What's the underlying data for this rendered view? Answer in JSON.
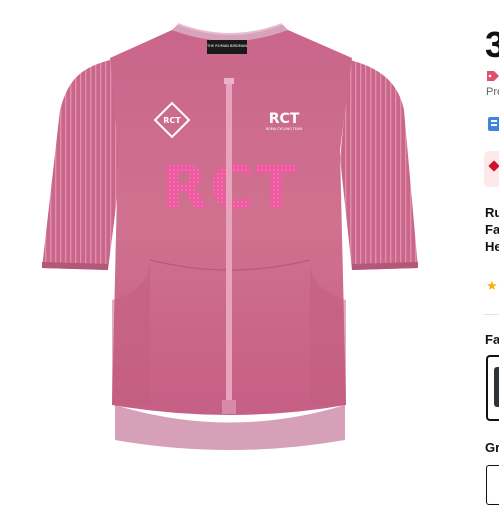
{
  "product": {
    "tag_label": "THE ROMAN BIRDMAN",
    "chest_badge": "RCT",
    "chest_logo": "RCT",
    "chest_sub": "ROMA CYCLING TEAM",
    "front_print": "RCT",
    "colors": {
      "body": "#cd6d8e",
      "sleeve": "#c96689",
      "zip": "#e8a4bc",
      "front_print": "#ee5aa0",
      "collar": "#d7a3bb"
    }
  },
  "detail": {
    "price": "3",
    "pre_text": "Pre",
    "title_lines": [
      "Ru",
      "Fa",
      "He"
    ],
    "favorites_label": "Fa",
    "grid_label": "Gr"
  },
  "icons": [
    "promo-icon",
    "badge-icon",
    "alert-icon",
    "star-icon"
  ]
}
